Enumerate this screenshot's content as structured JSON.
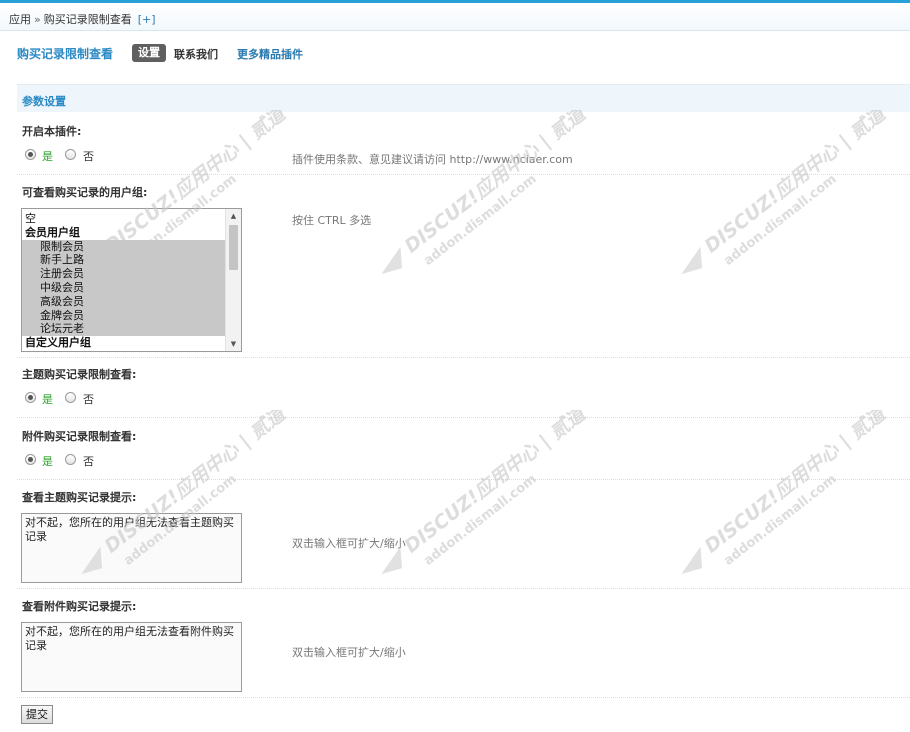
{
  "breadcrumb": {
    "root": "应用",
    "separator": "»",
    "current": "购买记录限制查看",
    "add": "[+]"
  },
  "nav": {
    "title": "购买记录限制查看",
    "tab_settings": "设置",
    "tab_contact": "联系我们",
    "tab_more": "更多精品插件"
  },
  "section": {
    "title": "参数设置"
  },
  "fields": {
    "enable": {
      "label": "开启本插件:",
      "yes": "是",
      "no": "否",
      "selected": "yes",
      "hint": "插件使用条款、意见建议请访问 http://www.nciaer.com"
    },
    "groups": {
      "label": "可查看购买记录的用户组:",
      "hint": "按住 CTRL 多选",
      "options": [
        {
          "text": "空",
          "type": "plain",
          "selected": false
        },
        {
          "text": "会员用户组",
          "type": "group",
          "selected": false
        },
        {
          "text": "限制会员",
          "type": "child",
          "selected": true
        },
        {
          "text": "新手上路",
          "type": "child",
          "selected": true
        },
        {
          "text": "注册会员",
          "type": "child",
          "selected": true
        },
        {
          "text": "中级会员",
          "type": "child",
          "selected": true
        },
        {
          "text": "高级会员",
          "type": "child",
          "selected": true
        },
        {
          "text": "金牌会员",
          "type": "child",
          "selected": true
        },
        {
          "text": "论坛元老",
          "type": "child",
          "selected": true
        },
        {
          "text": "自定义用户组",
          "type": "group",
          "selected": false
        }
      ]
    },
    "thread_limit": {
      "label": "主题购买记录限制查看:",
      "yes": "是",
      "no": "否",
      "selected": "yes"
    },
    "attach_limit": {
      "label": "附件购买记录限制查看:",
      "yes": "是",
      "no": "否",
      "selected": "yes"
    },
    "thread_tip": {
      "label": "查看主题购买记录提示:",
      "value": "对不起，您所在的用户组无法查看主题购买记录",
      "hint": "双击输入框可扩大/缩小"
    },
    "attach_tip": {
      "label": "查看附件购买记录提示:",
      "value": "对不起，您所在的用户组无法查看附件购买记录",
      "hint": "双击输入框可扩大/缩小"
    }
  },
  "submit_label": "提交",
  "watermark": {
    "line1": "DISCUZ!应用中心 | 贰道",
    "line2": "addon.dismall.com"
  },
  "colors": {
    "accent": "#2a8ac6",
    "yes_text": "#2aa02a",
    "topbar_border": "#2aa0d8",
    "watermark": "#c8c8c8"
  }
}
